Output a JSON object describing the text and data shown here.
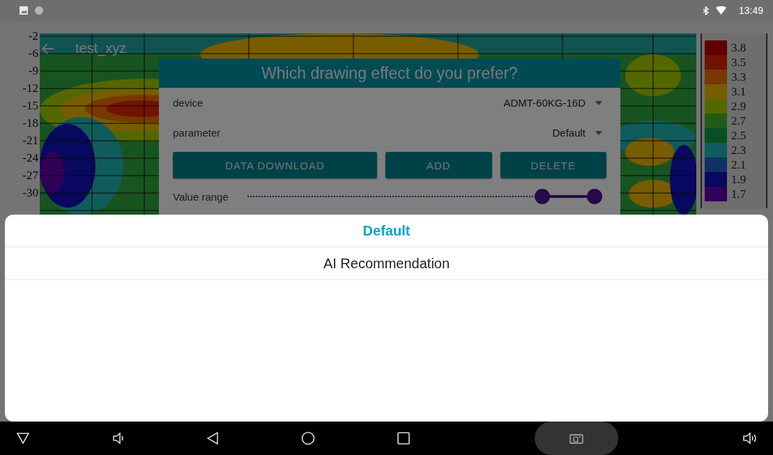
{
  "status_bar": {
    "time": "13:49"
  },
  "toolbar": {
    "title": "test_xyz"
  },
  "plot": {
    "y_labels": [
      "-2",
      "-6",
      "-9",
      "-12",
      "-15",
      "-18",
      "-21",
      "-24",
      "-27",
      "-30"
    ]
  },
  "legend": [
    {
      "label": "3.8",
      "color": "#600000"
    },
    {
      "label": "3.5",
      "color": "#701400"
    },
    {
      "label": "3.3",
      "color": "#783800"
    },
    {
      "label": "3.1",
      "color": "#785c00"
    },
    {
      "label": "2.9",
      "color": "#546800"
    },
    {
      "label": "2.7",
      "color": "#205c18"
    },
    {
      "label": "2.5",
      "color": "#085024"
    },
    {
      "label": "2.3",
      "color": "#105c5c"
    },
    {
      "label": "2.1",
      "color": "#103068"
    },
    {
      "label": "1.9",
      "color": "#080860"
    },
    {
      "label": "1.7",
      "color": "#300058"
    }
  ],
  "dialog": {
    "title": "Which drawing effect do you prefer?",
    "fields": [
      {
        "label": "device",
        "value": "ADMT-60KG-16D"
      },
      {
        "label": "parameter",
        "value": "Default"
      }
    ],
    "buttons": [
      "DATA DOWNLOAD",
      "ADD",
      "DELETE"
    ],
    "range": {
      "label": "Value range",
      "thumbs": [
        {
          "level": 0.85
        },
        {
          "level": 1
        }
      ]
    }
  },
  "sheet": {
    "options": [
      {
        "label": "Default",
        "selected": true
      },
      {
        "label": "AI Recommendation",
        "selected": false
      }
    ]
  }
}
